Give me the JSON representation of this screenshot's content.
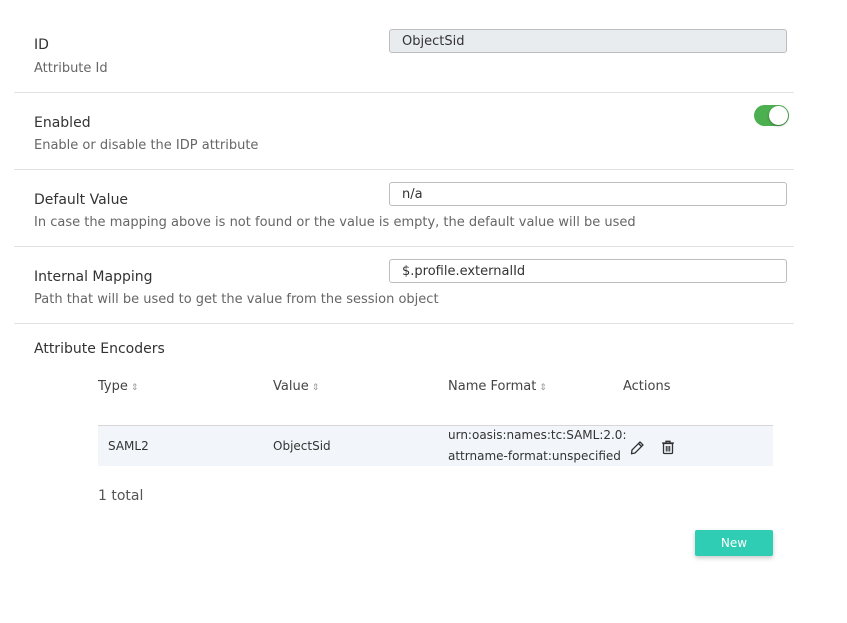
{
  "fields": {
    "id": {
      "label": "ID",
      "description": "Attribute Id",
      "value": "ObjectSid"
    },
    "enabled": {
      "label": "Enabled",
      "description": "Enable or disable the IDP attribute",
      "toggle_state": "on",
      "toggle_color": "#4caf50"
    },
    "default_value": {
      "label": "Default Value",
      "description": "In case the mapping above is not found or the value is empty, the default value will be used",
      "value": "n/a"
    },
    "internal_mapping": {
      "label": "Internal Mapping",
      "description": "Path that will be used to get the value from the session object",
      "value": "$.profile.externalId"
    }
  },
  "encoders": {
    "title": "Attribute Encoders",
    "columns": [
      "Type",
      "Value",
      "Name Format",
      "Actions"
    ],
    "rows": [
      {
        "type": "SAML2",
        "value": "ObjectSid",
        "name_format_line1": "urn:oasis:names:tc:SAML:2.0:",
        "name_format_line2": "attrname-format:unspecified",
        "actions": [
          "edit-icon",
          "delete-icon"
        ]
      }
    ],
    "total": "1 total",
    "new_button": "New",
    "accent_color": "#2fcdb4"
  }
}
